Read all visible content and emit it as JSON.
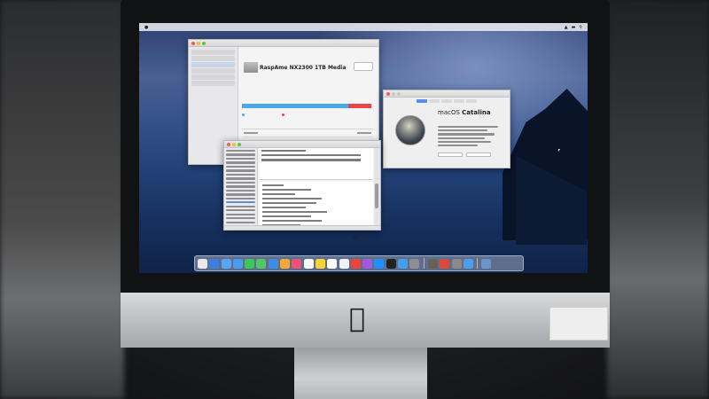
{
  "scene": {
    "device": "iMac",
    "desktop_wallpaper": "macOS Catalina"
  },
  "disk_utility": {
    "drive_name": "RaspAme NX2300 1TB Media",
    "usage_colors": {
      "used": "#48a8ea",
      "free": "#e6474c"
    },
    "used_fraction": 0.82
  },
  "about_mac": {
    "os_name_prefix": "macOS",
    "os_name": "Catalina"
  },
  "dock": {
    "icon_colors": [
      "#e9e9e9",
      "#3f7ee0",
      "#5aa5f2",
      "#4a9cf0",
      "#3ec45a",
      "#52c865",
      "#3a8fe8",
      "#f2a83a",
      "#f34d7a",
      "#f7f7f7",
      "#f7d23e",
      "#ffffff",
      "#f2f2f2",
      "#e9463f",
      "#a457e0",
      "#1e90ff",
      "#222222",
      "#3ea0f0",
      "#8e8e93",
      "#6a5f55",
      "#d84a3a",
      "#8a8a8d",
      "#4aa0e8",
      "#6b95c7"
    ]
  },
  "colors": {
    "wallpaper_sky": "#4a5f92",
    "wallpaper_sea": "#16305d"
  }
}
